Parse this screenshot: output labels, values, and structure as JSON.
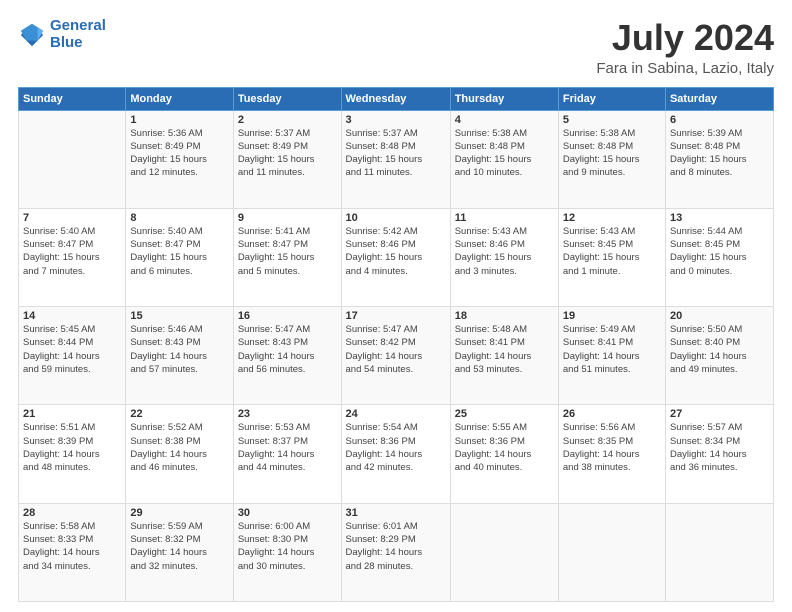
{
  "logo": {
    "line1": "General",
    "line2": "Blue"
  },
  "title": "July 2024",
  "subtitle": "Fara in Sabina, Lazio, Italy",
  "days_header": [
    "Sunday",
    "Monday",
    "Tuesday",
    "Wednesday",
    "Thursday",
    "Friday",
    "Saturday"
  ],
  "weeks": [
    [
      {
        "num": "",
        "info": ""
      },
      {
        "num": "1",
        "info": "Sunrise: 5:36 AM\nSunset: 8:49 PM\nDaylight: 15 hours\nand 12 minutes."
      },
      {
        "num": "2",
        "info": "Sunrise: 5:37 AM\nSunset: 8:49 PM\nDaylight: 15 hours\nand 11 minutes."
      },
      {
        "num": "3",
        "info": "Sunrise: 5:37 AM\nSunset: 8:48 PM\nDaylight: 15 hours\nand 11 minutes."
      },
      {
        "num": "4",
        "info": "Sunrise: 5:38 AM\nSunset: 8:48 PM\nDaylight: 15 hours\nand 10 minutes."
      },
      {
        "num": "5",
        "info": "Sunrise: 5:38 AM\nSunset: 8:48 PM\nDaylight: 15 hours\nand 9 minutes."
      },
      {
        "num": "6",
        "info": "Sunrise: 5:39 AM\nSunset: 8:48 PM\nDaylight: 15 hours\nand 8 minutes."
      }
    ],
    [
      {
        "num": "7",
        "info": "Sunrise: 5:40 AM\nSunset: 8:47 PM\nDaylight: 15 hours\nand 7 minutes."
      },
      {
        "num": "8",
        "info": "Sunrise: 5:40 AM\nSunset: 8:47 PM\nDaylight: 15 hours\nand 6 minutes."
      },
      {
        "num": "9",
        "info": "Sunrise: 5:41 AM\nSunset: 8:47 PM\nDaylight: 15 hours\nand 5 minutes."
      },
      {
        "num": "10",
        "info": "Sunrise: 5:42 AM\nSunset: 8:46 PM\nDaylight: 15 hours\nand 4 minutes."
      },
      {
        "num": "11",
        "info": "Sunrise: 5:43 AM\nSunset: 8:46 PM\nDaylight: 15 hours\nand 3 minutes."
      },
      {
        "num": "12",
        "info": "Sunrise: 5:43 AM\nSunset: 8:45 PM\nDaylight: 15 hours\nand 1 minute."
      },
      {
        "num": "13",
        "info": "Sunrise: 5:44 AM\nSunset: 8:45 PM\nDaylight: 15 hours\nand 0 minutes."
      }
    ],
    [
      {
        "num": "14",
        "info": "Sunrise: 5:45 AM\nSunset: 8:44 PM\nDaylight: 14 hours\nand 59 minutes."
      },
      {
        "num": "15",
        "info": "Sunrise: 5:46 AM\nSunset: 8:43 PM\nDaylight: 14 hours\nand 57 minutes."
      },
      {
        "num": "16",
        "info": "Sunrise: 5:47 AM\nSunset: 8:43 PM\nDaylight: 14 hours\nand 56 minutes."
      },
      {
        "num": "17",
        "info": "Sunrise: 5:47 AM\nSunset: 8:42 PM\nDaylight: 14 hours\nand 54 minutes."
      },
      {
        "num": "18",
        "info": "Sunrise: 5:48 AM\nSunset: 8:41 PM\nDaylight: 14 hours\nand 53 minutes."
      },
      {
        "num": "19",
        "info": "Sunrise: 5:49 AM\nSunset: 8:41 PM\nDaylight: 14 hours\nand 51 minutes."
      },
      {
        "num": "20",
        "info": "Sunrise: 5:50 AM\nSunset: 8:40 PM\nDaylight: 14 hours\nand 49 minutes."
      }
    ],
    [
      {
        "num": "21",
        "info": "Sunrise: 5:51 AM\nSunset: 8:39 PM\nDaylight: 14 hours\nand 48 minutes."
      },
      {
        "num": "22",
        "info": "Sunrise: 5:52 AM\nSunset: 8:38 PM\nDaylight: 14 hours\nand 46 minutes."
      },
      {
        "num": "23",
        "info": "Sunrise: 5:53 AM\nSunset: 8:37 PM\nDaylight: 14 hours\nand 44 minutes."
      },
      {
        "num": "24",
        "info": "Sunrise: 5:54 AM\nSunset: 8:36 PM\nDaylight: 14 hours\nand 42 minutes."
      },
      {
        "num": "25",
        "info": "Sunrise: 5:55 AM\nSunset: 8:36 PM\nDaylight: 14 hours\nand 40 minutes."
      },
      {
        "num": "26",
        "info": "Sunrise: 5:56 AM\nSunset: 8:35 PM\nDaylight: 14 hours\nand 38 minutes."
      },
      {
        "num": "27",
        "info": "Sunrise: 5:57 AM\nSunset: 8:34 PM\nDaylight: 14 hours\nand 36 minutes."
      }
    ],
    [
      {
        "num": "28",
        "info": "Sunrise: 5:58 AM\nSunset: 8:33 PM\nDaylight: 14 hours\nand 34 minutes."
      },
      {
        "num": "29",
        "info": "Sunrise: 5:59 AM\nSunset: 8:32 PM\nDaylight: 14 hours\nand 32 minutes."
      },
      {
        "num": "30",
        "info": "Sunrise: 6:00 AM\nSunset: 8:30 PM\nDaylight: 14 hours\nand 30 minutes."
      },
      {
        "num": "31",
        "info": "Sunrise: 6:01 AM\nSunset: 8:29 PM\nDaylight: 14 hours\nand 28 minutes."
      },
      {
        "num": "",
        "info": ""
      },
      {
        "num": "",
        "info": ""
      },
      {
        "num": "",
        "info": ""
      }
    ]
  ]
}
